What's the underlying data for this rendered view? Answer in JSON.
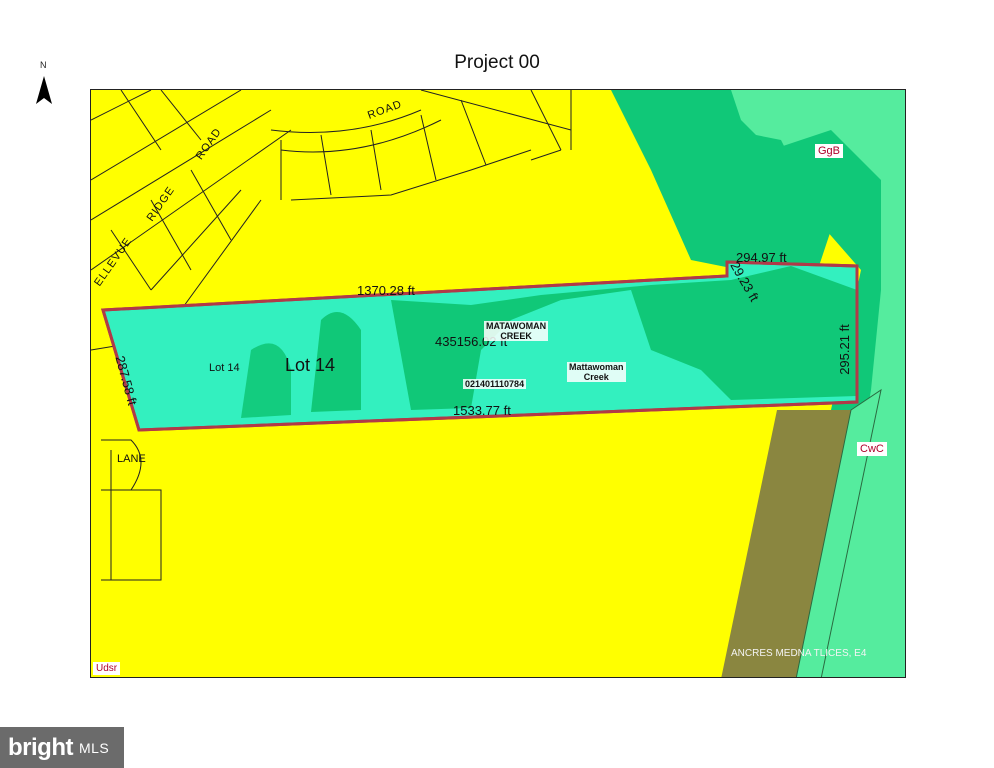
{
  "title": "Project 00",
  "north_label": "N",
  "colors": {
    "parcel_fill": "#ffff00",
    "stream_valley": "#10c878",
    "lot_fill": "#33f0bf",
    "light_green": "#55ec9e",
    "olive": "#8a8640",
    "boundary": "#b03a48"
  },
  "roads": {
    "road": "ROAD",
    "ridge": "RIDGE",
    "road2": "ROAD",
    "bellevue": "ELLEVUE",
    "lane": "LANE"
  },
  "lot": {
    "name_large": "Lot 14",
    "name_small": "Lot 14",
    "area": "435156.02 ft",
    "parcel_id": "021401110784"
  },
  "dimensions": {
    "north_side": "1370.28 ft",
    "south_side": "1533.77 ft",
    "west_side": "287.58 ft",
    "east_side": "295.21 ft",
    "ne_side": "294.97 ft",
    "notch_side": "29.23 ft"
  },
  "creek": {
    "label_caps_line1": "MATAWOMAN",
    "label_caps_line2": "CREEK",
    "label_line1": "Mattawoman",
    "label_line2": "Creek"
  },
  "soils": {
    "ggb": "GgB",
    "cwc": "CwC",
    "udsr": "Udsr"
  },
  "bottom_note": "ANCRES MEDNA TLICES, E4",
  "brand": {
    "name": "bright",
    "suffix": "MLS"
  }
}
